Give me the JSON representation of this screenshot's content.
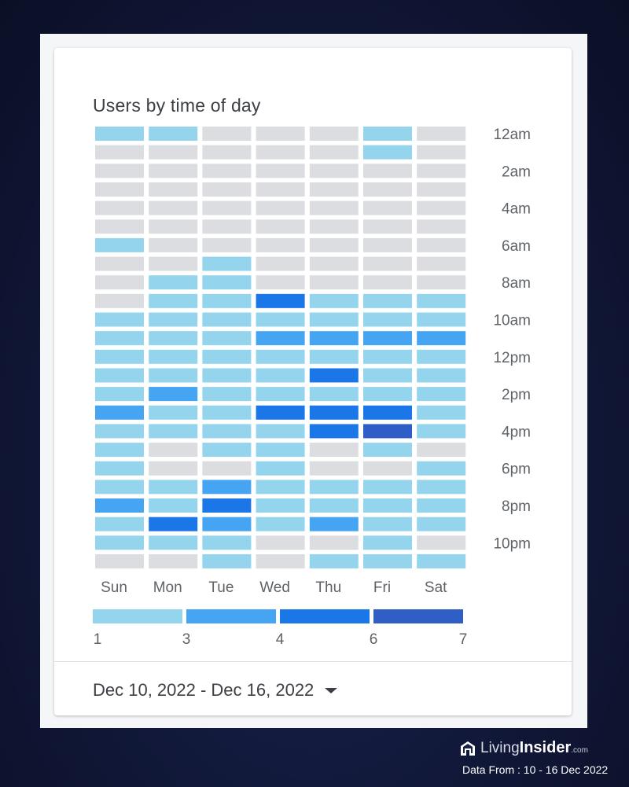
{
  "card": {
    "title": "Users by time of day",
    "date_range": "Dec 10, 2022 - Dec 16, 2022"
  },
  "branding": {
    "logo_icon": "house-logo-icon",
    "name_part1": "Living",
    "name_part2": "Insider",
    "suffix": ".com",
    "data_from": "Data From : 10 - 16 Dec 2022"
  },
  "chart_data": {
    "type": "heatmap",
    "title": "Users by time of day",
    "columns": [
      "Sun",
      "Mon",
      "Tue",
      "Wed",
      "Thu",
      "Fri",
      "Sat"
    ],
    "rows": [
      "12am",
      "1am",
      "2am",
      "3am",
      "4am",
      "5am",
      "6am",
      "7am",
      "8am",
      "9am",
      "10am",
      "11am",
      "12pm",
      "1pm",
      "2pm",
      "3pm",
      "4pm",
      "5pm",
      "6pm",
      "7pm",
      "8pm",
      "9pm",
      "10pm",
      "11pm"
    ],
    "row_labels_shown": [
      "12am",
      "",
      "2am",
      "",
      "4am",
      "",
      "6am",
      "",
      "8am",
      "",
      "10am",
      "",
      "12pm",
      "",
      "2pm",
      "",
      "4pm",
      "",
      "6pm",
      "",
      "8pm",
      "",
      "10pm",
      ""
    ],
    "value_encoding": "0 = no users (grey); 1..4 = color bucket index from legend",
    "values": [
      [
        1,
        1,
        0,
        0,
        0,
        1,
        0
      ],
      [
        0,
        0,
        0,
        0,
        0,
        1,
        0
      ],
      [
        0,
        0,
        0,
        0,
        0,
        0,
        0
      ],
      [
        0,
        0,
        0,
        0,
        0,
        0,
        0
      ],
      [
        0,
        0,
        0,
        0,
        0,
        0,
        0
      ],
      [
        0,
        0,
        0,
        0,
        0,
        0,
        0
      ],
      [
        1,
        0,
        0,
        0,
        0,
        0,
        0
      ],
      [
        0,
        0,
        1,
        0,
        0,
        0,
        0
      ],
      [
        0,
        1,
        1,
        0,
        0,
        0,
        0
      ],
      [
        0,
        1,
        1,
        3,
        1,
        1,
        1
      ],
      [
        1,
        1,
        1,
        1,
        1,
        1,
        1
      ],
      [
        1,
        1,
        1,
        2,
        2,
        2,
        2
      ],
      [
        1,
        1,
        1,
        1,
        1,
        1,
        1
      ],
      [
        1,
        1,
        1,
        1,
        3,
        1,
        1
      ],
      [
        1,
        2,
        1,
        1,
        1,
        1,
        1
      ],
      [
        2,
        1,
        1,
        3,
        3,
        3,
        1
      ],
      [
        1,
        1,
        1,
        1,
        3,
        4,
        1
      ],
      [
        1,
        0,
        1,
        1,
        0,
        1,
        0
      ],
      [
        1,
        0,
        0,
        1,
        0,
        0,
        1
      ],
      [
        1,
        1,
        2,
        1,
        1,
        1,
        1
      ],
      [
        2,
        1,
        3,
        1,
        1,
        1,
        1
      ],
      [
        1,
        3,
        2,
        1,
        2,
        1,
        1
      ],
      [
        1,
        1,
        1,
        0,
        0,
        1,
        0
      ],
      [
        0,
        0,
        1,
        0,
        1,
        1,
        1
      ]
    ],
    "empty_color": "#dcdde1",
    "legend": {
      "colors": [
        "#94d5ed",
        "#46a5f3",
        "#1b76e8",
        "#2f5fc6"
      ],
      "tick_labels": [
        "1",
        "3",
        "4",
        "6",
        "7"
      ],
      "range": [
        1,
        7
      ]
    },
    "grid": false,
    "legend_position": "bottom"
  }
}
